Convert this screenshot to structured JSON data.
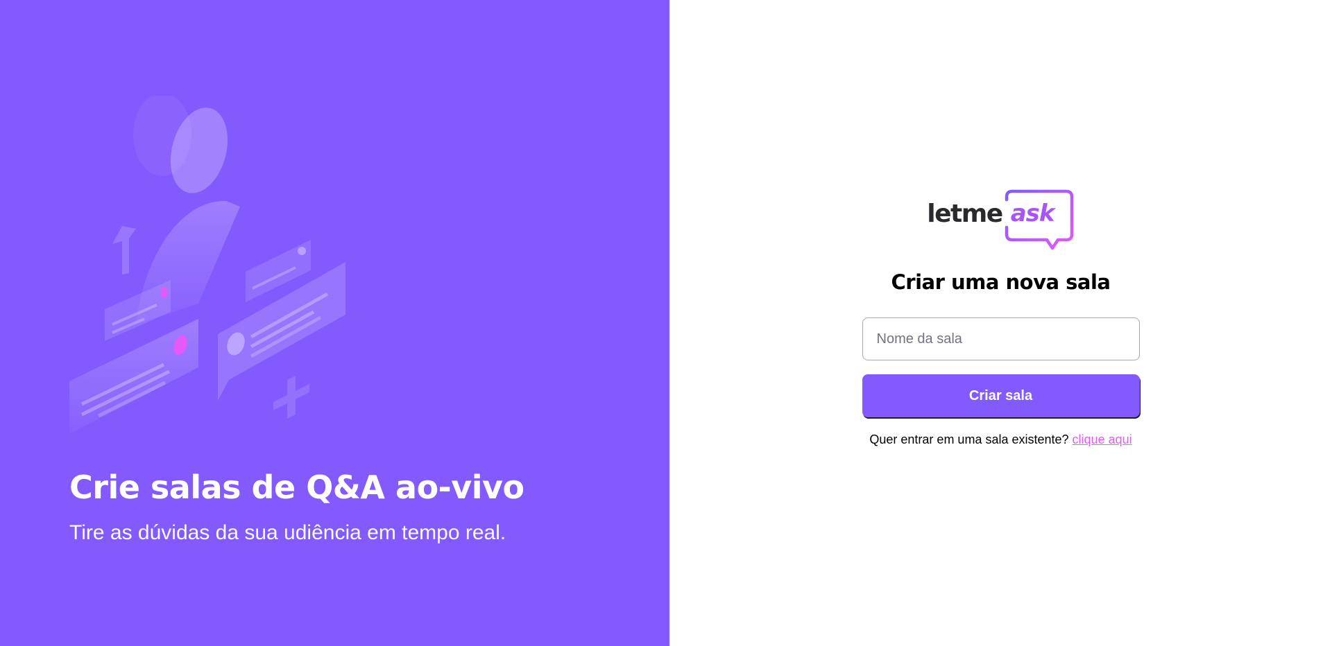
{
  "aside": {
    "illustration": "qa-illustration",
    "title": "Crie salas de Q&A ao-vivo",
    "subtitle": "Tire as dúvidas da sua udiência em tempo real."
  },
  "logo": {
    "part1": "letme",
    "part2": "ask"
  },
  "form": {
    "title": "Criar uma nova sala",
    "input_placeholder": "Nome da sala",
    "input_value": "",
    "button_label": "Criar sala",
    "join_prompt": "Quer entrar em uma sala existente?",
    "join_link": "clique aqui"
  },
  "colors": {
    "primary": "#835afd",
    "accent_pink": "#e559f9",
    "text_dark": "#29292e",
    "border": "#a8a8b3"
  }
}
